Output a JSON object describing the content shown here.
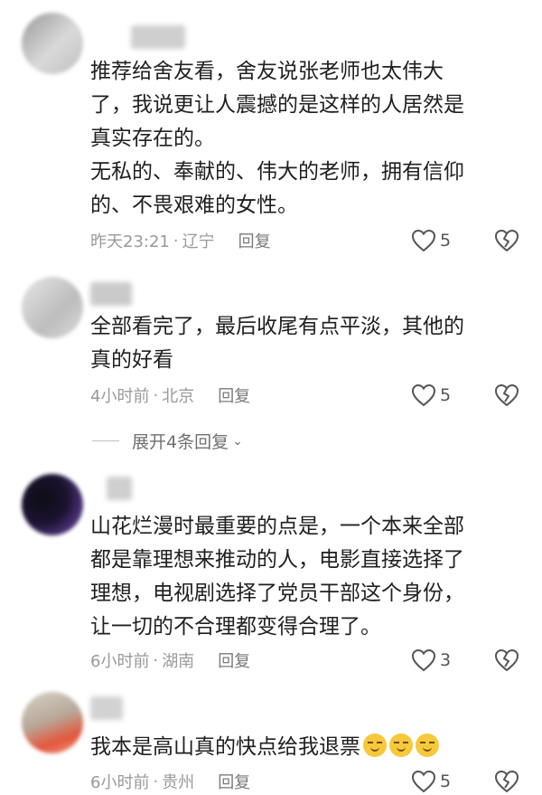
{
  "comments": [
    {
      "lines": [
        "推荐给舍友看，舍友说张老师也太伟大",
        "了，我说更让人震撼的是这样的人居然是",
        "真实存在的。",
        "无私的、奉献的、伟大的老师，拥有信仰",
        "的、不畏艰难的女性。"
      ],
      "time": "昨天23:21",
      "location": "辽宁",
      "reply": "回复",
      "likes": "5"
    },
    {
      "lines": [
        "全部看完了，最后收尾有点平淡，其他的",
        "真的好看"
      ],
      "time": "4小时前",
      "location": "北京",
      "reply": "回复",
      "likes": "5",
      "expand_label": "展开4条回复"
    },
    {
      "lines": [
        "山花烂漫时最重要的点是，一个本来全部",
        "都是靠理想来推动的人，电影直接选择了",
        "理想，电视剧选择了党员干部这个身份，",
        "让一切的不合理都变得合理了。"
      ],
      "time": "6小时前",
      "location": "湖南",
      "reply": "回复",
      "likes": "3"
    },
    {
      "lines": [
        "我本是高山真的快点给我退票"
      ],
      "time": "6小时前",
      "location": "贵州",
      "reply": "回复",
      "likes": "5"
    }
  ],
  "separator": "·",
  "icons": {
    "like": "heart-outline-icon",
    "dislike": "broken-heart-icon",
    "expand": "chevron-down-icon",
    "emoji": "awkward-smile-emoji"
  },
  "colors": {
    "text": "#202020",
    "meta": "#9a9a9a",
    "icon": "#555555"
  }
}
